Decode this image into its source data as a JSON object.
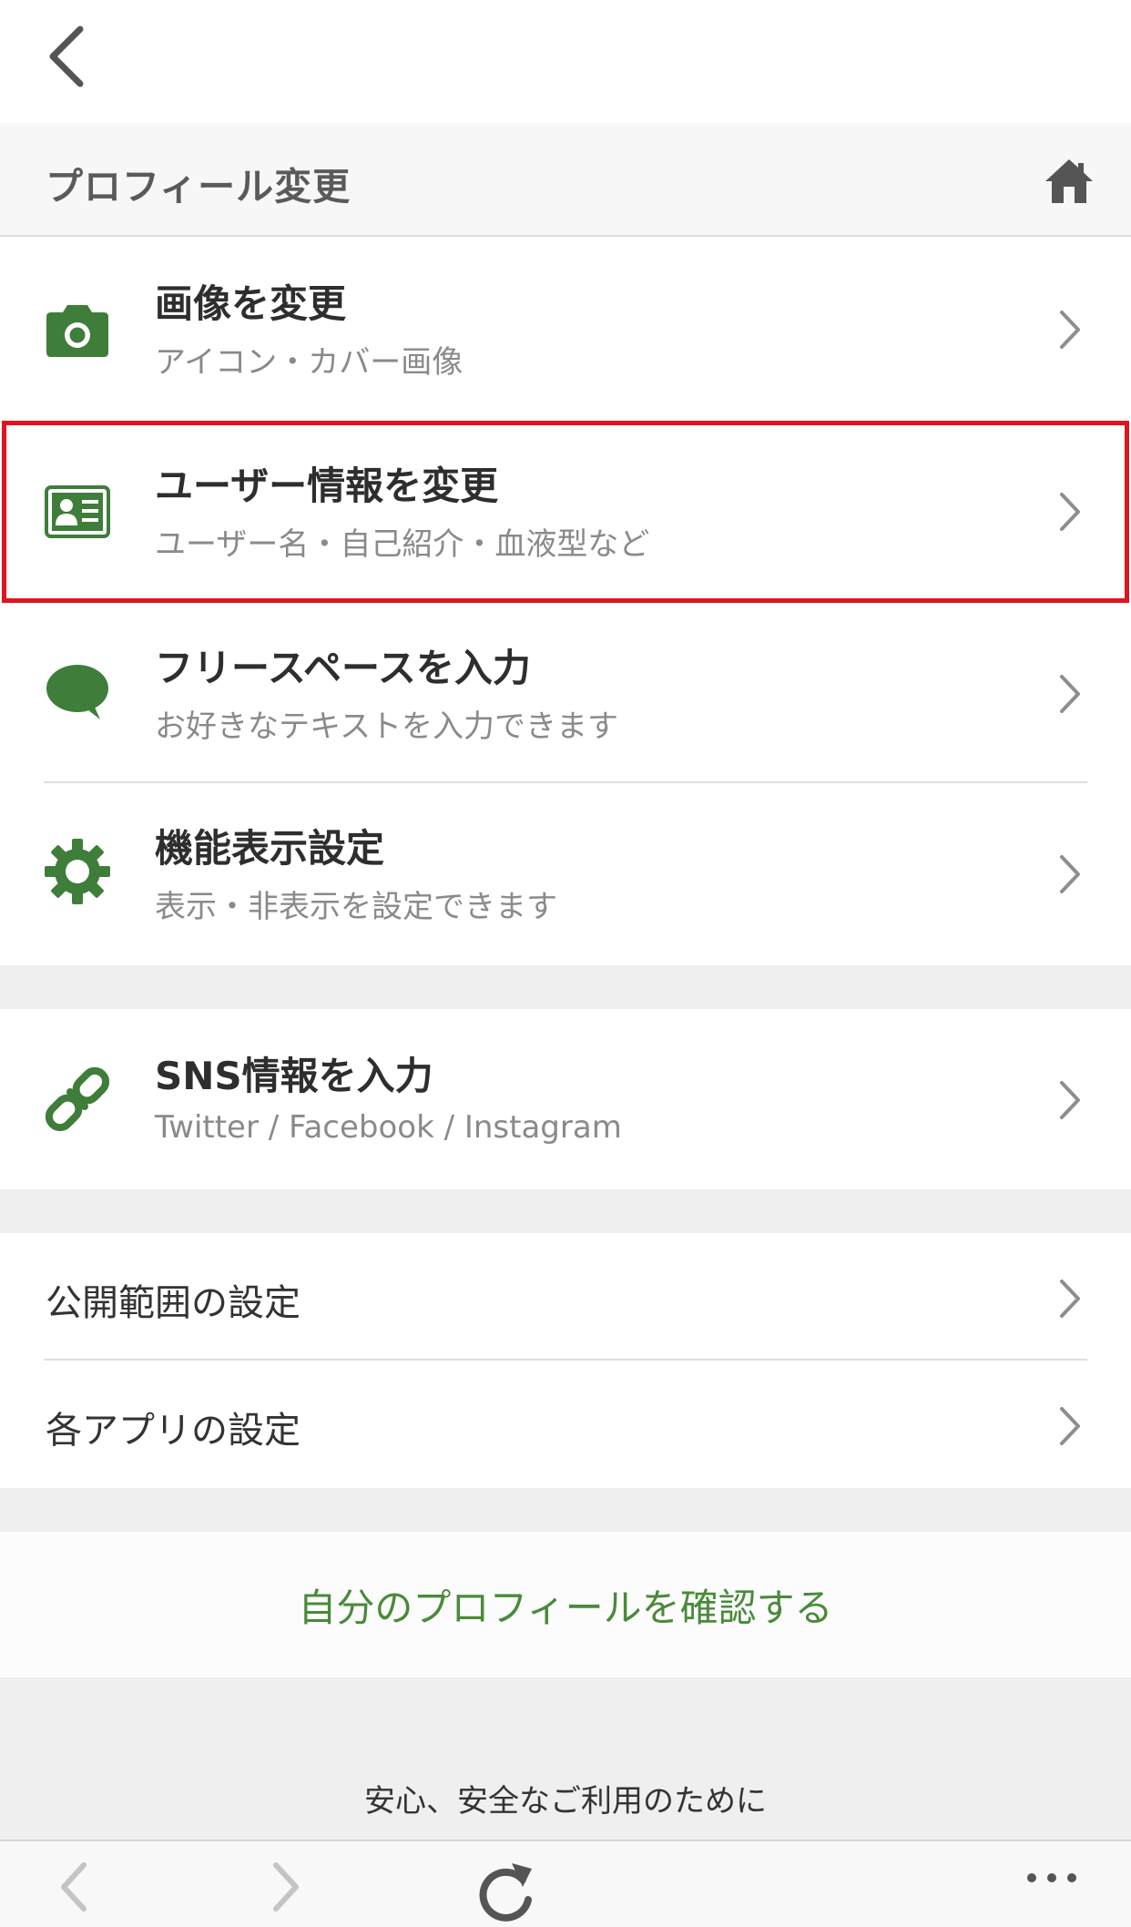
{
  "header": {
    "title": "プロフィール変更"
  },
  "menu_group1": [
    {
      "title": "画像を変更",
      "subtitle": "アイコン・カバー画像",
      "icon": "camera-icon"
    },
    {
      "title": "ユーザー情報を変更",
      "subtitle": "ユーザー名・自己紹介・血液型など",
      "icon": "id-card-icon"
    },
    {
      "title": "フリースペースを入力",
      "subtitle": "お好きなテキストを入力できます",
      "icon": "speech-bubble-icon"
    },
    {
      "title": "機能表示設定",
      "subtitle": "表示・非表示を設定できます",
      "icon": "gear-icon"
    }
  ],
  "menu_group2": [
    {
      "title": "SNS情報を入力",
      "subtitle": "Twitter / Facebook / Instagram",
      "icon": "link-icon"
    }
  ],
  "menu_group3": [
    {
      "label": "公開範囲の設定"
    },
    {
      "label": "各アプリの設定"
    }
  ],
  "confirm_link": "自分のプロフィールを確認する",
  "footer_text": "安心、安全なご利用のために",
  "colors": {
    "accent": "#3f7d3a",
    "highlight": "#e0141e",
    "link": "#4a8a3a"
  }
}
